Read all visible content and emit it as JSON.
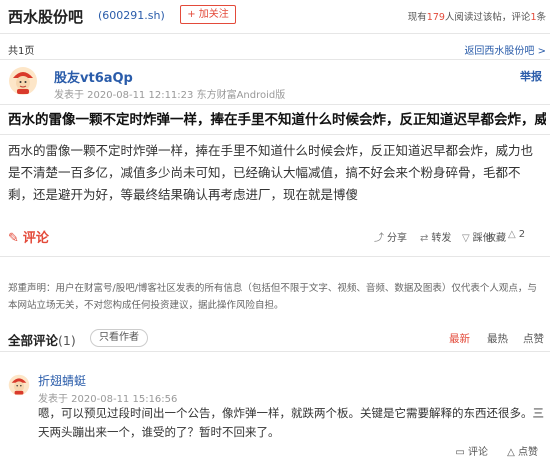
{
  "header": {
    "bar_name": "西水股份吧",
    "stock_code": "(600291.sh)",
    "follow_label": "+ 加关注",
    "readers_prefix": "现有",
    "readers_count": "179",
    "readers_mid": "人阅读过该帖，评论",
    "comments_count": "1",
    "readers_suffix": "条"
  },
  "pager": {
    "page_count": "共1页",
    "return_link": "返回西水股份吧 >"
  },
  "post": {
    "author": "股友vt6aQp",
    "meta": "发表于 2020-08-11 12:11:23 东方财富Android版",
    "report": "举报",
    "title": "西水的雷像一颗不定时炸弹一样，捧在手里不知道什么时候会炸，反正知道迟早都会炸，威",
    "body": "西水的雷像一颗不定时炸弹一样，捧在手里不知道什么时候会炸，反正知道迟早都会炸，威力也是不清楚一百多亿，减值多少尚未可知，已经确认大幅减值，搞不好会来个粉身碎骨，毛都不剩，还是避开为好，等最终结果确认再考虑进厂，现在就是博傻"
  },
  "actions": {
    "comment": "评论",
    "share": "分享",
    "repost": "转发",
    "thumb_down": "踩他",
    "favorite": "收藏",
    "like_count": "2"
  },
  "disclaimer": "郑重声明：用户在财富号/股吧/博客社区发表的所有信息（包括但不限于文字、视频、音频、数据及图表）仅代表个人观点，与本网站立场无关，不对您构成任何投资建议，据此操作风险自担。",
  "comments_header": {
    "title": "全部评论",
    "count": "(1)",
    "only_author": "只看作者",
    "sort_latest": "最新",
    "sort_hot": "最热",
    "sort_like": "点赞"
  },
  "comments": [
    {
      "author": "折翅蜻蜓",
      "meta": "发表于 2020-08-11 15:16:56",
      "text": "嗯，可以预见过段时间出一个公告，像炸弹一样，就跌两个板。关键是它需要解释的东西还很多。三天两头蹦出来一个，谁受的了？暂时不回来了。",
      "reply": "评论",
      "like": "点赞"
    }
  ],
  "colors": {
    "accent": "#e34a3a",
    "link": "#2a5caa"
  }
}
